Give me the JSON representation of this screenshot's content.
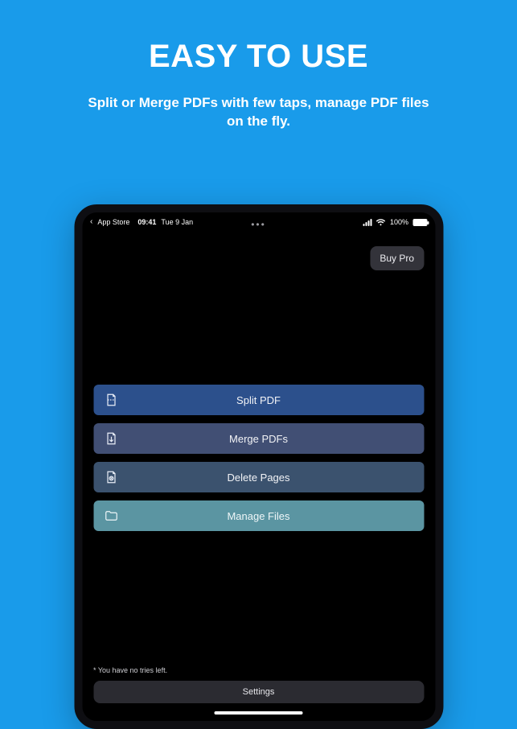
{
  "promo": {
    "title": "EASY TO USE",
    "subtitle": "Split or Merge PDFs with few taps, manage PDF files on the fly."
  },
  "statusbar": {
    "back_label": "App Store",
    "time": "09:41",
    "date": "Tue 9 Jan",
    "ellipsis": "•••",
    "battery_pct": "100%"
  },
  "header": {
    "buy_pro_label": "Buy Pro"
  },
  "actions": {
    "split": {
      "label": "Split PDF"
    },
    "merge": {
      "label": "Merge PDFs"
    },
    "delete": {
      "label": "Delete Pages"
    },
    "manage": {
      "label": "Manage Files"
    }
  },
  "footer": {
    "tries_note": "* You have no tries left.",
    "settings_label": "Settings"
  },
  "colors": {
    "background": "#199bea",
    "split": "#2c508c",
    "merge": "#414f74",
    "delete": "#3b526e",
    "manage": "#5b95a2"
  }
}
